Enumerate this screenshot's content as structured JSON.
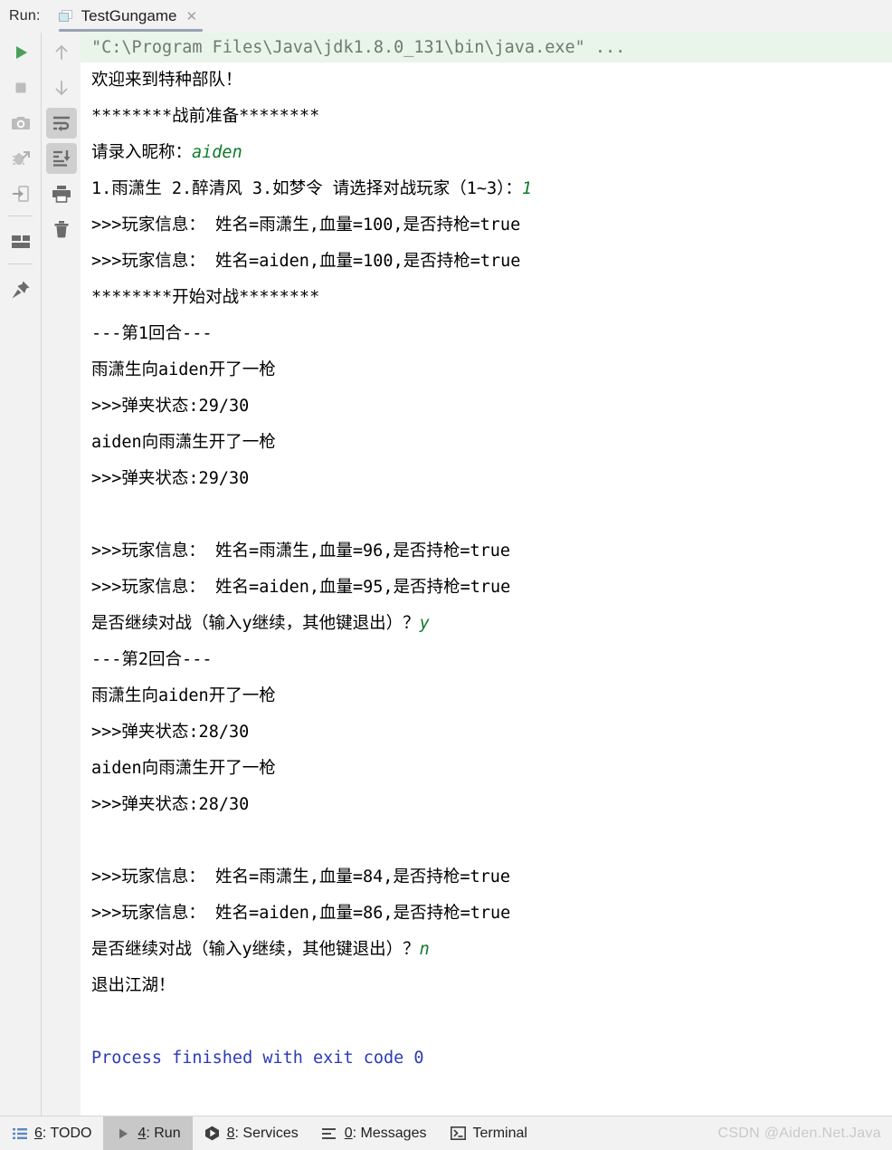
{
  "window": {
    "run_label": "Run:",
    "accent_tab_underline": "#97a2b4"
  },
  "tab": {
    "title": "TestGungame",
    "close_glyph": "✕",
    "icon": "java-class-icon"
  },
  "left_toolbar": {
    "buttons": [
      {
        "name": "rerun-button",
        "icon": "play-triangle-icon",
        "active": false
      },
      {
        "name": "stop-button",
        "icon": "stop-square-icon",
        "active": false
      },
      {
        "name": "screenshot-button",
        "icon": "camera-icon",
        "active": false
      },
      {
        "name": "restart-debug-button",
        "icon": "bug-restart-icon",
        "active": false
      },
      {
        "name": "dump-threads-button",
        "icon": "export-arrow-icon",
        "active": false
      },
      {
        "name": "layout-button",
        "icon": "layout-panels-icon",
        "active": false
      },
      {
        "name": "pin-tab-button",
        "icon": "pin-icon",
        "active": false
      }
    ]
  },
  "right_toolbar": {
    "buttons": [
      {
        "name": "previous-occurrence-button",
        "icon": "arrow-up-icon",
        "active": false
      },
      {
        "name": "next-occurrence-button",
        "icon": "arrow-down-icon",
        "active": false
      },
      {
        "name": "soft-wrap-button",
        "icon": "soft-wrap-icon",
        "active": true
      },
      {
        "name": "scroll-to-end-button",
        "icon": "scroll-to-end-icon",
        "active": true
      },
      {
        "name": "print-button",
        "icon": "printer-icon",
        "active": false
      },
      {
        "name": "clear-all-button",
        "icon": "trash-icon",
        "active": false
      }
    ]
  },
  "console": {
    "lines": [
      {
        "kind": "cmd",
        "text": "\"C:\\Program Files\\Java\\jdk1.8.0_131\\bin\\java.exe\" ..."
      },
      {
        "kind": "out",
        "text": "欢迎来到特种部队！"
      },
      {
        "kind": "out",
        "text": "********战前准备********"
      },
      {
        "kind": "mixed",
        "text": "请录入昵称：",
        "input": "aiden"
      },
      {
        "kind": "mixed",
        "text": "1.雨潇生 2.醉清风 3.如梦令 请选择对战玩家（1~3）：",
        "input": "1"
      },
      {
        "kind": "out",
        "text": ">>>玩家信息： 姓名=雨潇生,血量=100,是否持枪=true"
      },
      {
        "kind": "out",
        "text": ">>>玩家信息： 姓名=aiden,血量=100,是否持枪=true"
      },
      {
        "kind": "out",
        "text": "********开始对战********"
      },
      {
        "kind": "out",
        "text": "---第1回合---"
      },
      {
        "kind": "out",
        "text": "雨潇生向aiden开了一枪"
      },
      {
        "kind": "out",
        "text": ">>>弹夹状态:29/30"
      },
      {
        "kind": "out",
        "text": "aiden向雨潇生开了一枪"
      },
      {
        "kind": "out",
        "text": ">>>弹夹状态:29/30"
      },
      {
        "kind": "blank",
        "text": ""
      },
      {
        "kind": "out",
        "text": ">>>玩家信息： 姓名=雨潇生,血量=96,是否持枪=true"
      },
      {
        "kind": "out",
        "text": ">>>玩家信息： 姓名=aiden,血量=95,是否持枪=true"
      },
      {
        "kind": "mixed",
        "text": "是否继续对战（输入y继续，其他键退出）？",
        "input": "y"
      },
      {
        "kind": "out",
        "text": "---第2回合---"
      },
      {
        "kind": "out",
        "text": "雨潇生向aiden开了一枪"
      },
      {
        "kind": "out",
        "text": ">>>弹夹状态:28/30"
      },
      {
        "kind": "out",
        "text": "aiden向雨潇生开了一枪"
      },
      {
        "kind": "out",
        "text": ">>>弹夹状态:28/30"
      },
      {
        "kind": "blank",
        "text": ""
      },
      {
        "kind": "out",
        "text": ">>>玩家信息： 姓名=雨潇生,血量=84,是否持枪=true"
      },
      {
        "kind": "out",
        "text": ">>>玩家信息： 姓名=aiden,血量=86,是否持枪=true"
      },
      {
        "kind": "mixed",
        "text": "是否继续对战（输入y继续，其他键退出）？",
        "input": "n"
      },
      {
        "kind": "out",
        "text": "退出江湖！"
      },
      {
        "kind": "blank",
        "text": ""
      },
      {
        "kind": "finish",
        "text": "Process finished with exit code 0"
      }
    ],
    "colors": {
      "command_background": "#e9f5e9",
      "command_text": "#6f7a6f",
      "stdout_text": "#000000",
      "user_input_text": "#0f7a29",
      "exit_text": "#2b3ab8"
    }
  },
  "status_bar": {
    "items": [
      {
        "name": "status-todo",
        "icon": "list-icon",
        "num": "6",
        "label": ": TODO",
        "active": false
      },
      {
        "name": "status-run",
        "icon": "play-icon",
        "num": "4",
        "label": ": Run",
        "active": true
      },
      {
        "name": "status-services",
        "icon": "services-icon",
        "num": "8",
        "label": ": Services",
        "active": false
      },
      {
        "name": "status-messages",
        "icon": "messages-icon",
        "num": "0",
        "label": ": Messages",
        "active": false
      },
      {
        "name": "status-terminal",
        "icon": "terminal-icon",
        "num": "",
        "label": "Terminal",
        "active": false
      }
    ],
    "watermark": "CSDN @Aiden.Net.Java"
  }
}
